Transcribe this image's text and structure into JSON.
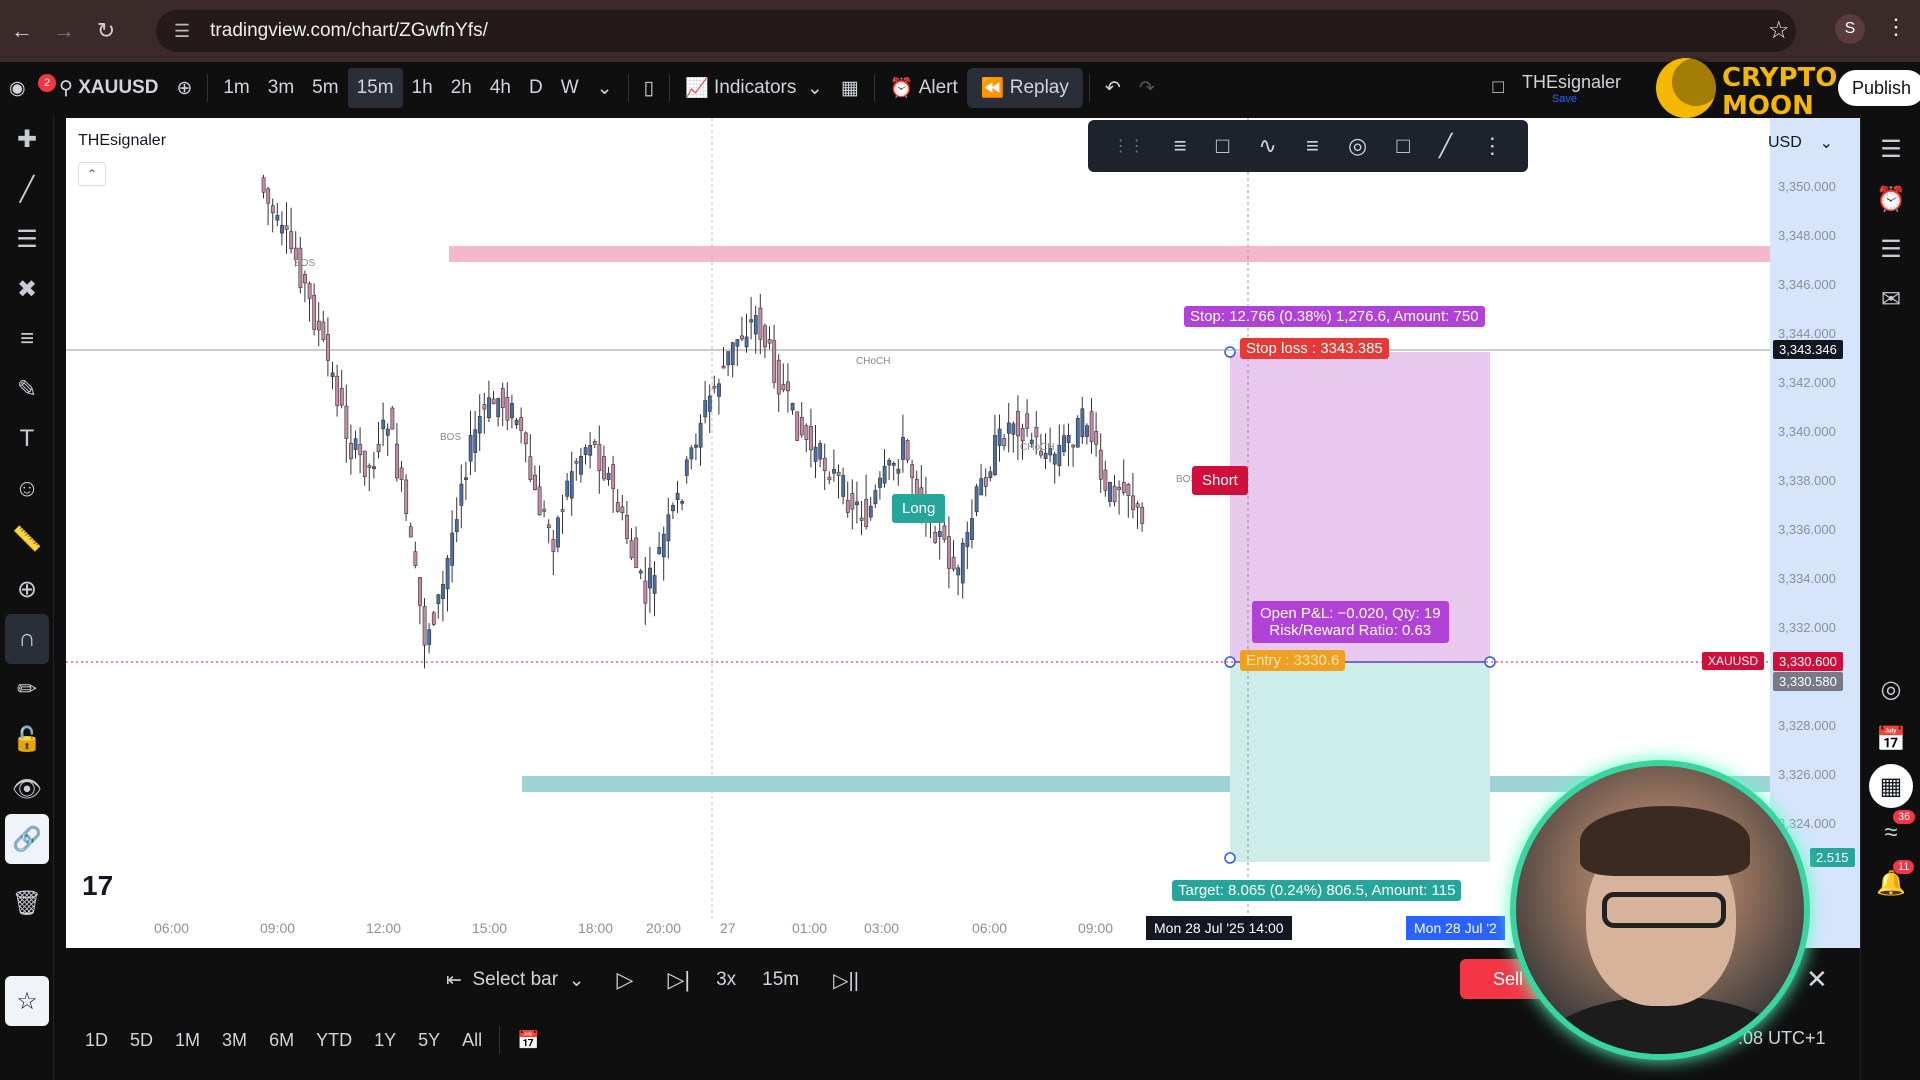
{
  "browser": {
    "url": "tradingview.com/chart/ZGwfnYfs/",
    "profile_initial": "S"
  },
  "toolbar": {
    "notification_count": "2",
    "symbol": "XAUUSD",
    "intervals": [
      "1m",
      "3m",
      "5m",
      "15m",
      "1h",
      "2h",
      "4h",
      "D",
      "W"
    ],
    "active_interval": "15m",
    "indicators_label": "Indicators",
    "alert_label": "Alert",
    "replay_label": "Replay",
    "account_name": "THEsignaler",
    "account_sub": "Save",
    "publish_label": "Publish",
    "logo_text": "CRYPTO MOON"
  },
  "chart": {
    "symbol_label": "THEsignaler",
    "currency": "USD",
    "price_ticks": [
      "3,350.000",
      "3,348.000",
      "3,346.000",
      "3,344.000",
      "3,342.000",
      "3,340.000",
      "3,338.000",
      "3,336.000",
      "3,334.000",
      "3,332.000",
      "3,330.000",
      "3,328.000",
      "3,326.000",
      "3,324.000"
    ],
    "time_ticks": [
      "06:00",
      "09:00",
      "12:00",
      "15:00",
      "18:00",
      "20:00",
      "27",
      "01:00",
      "03:00",
      "06:00",
      "09:00"
    ],
    "structure_labels": [
      "BOS",
      "BOS",
      "CHoCH",
      "CHoCH",
      "BOS"
    ],
    "stop_info": "Stop: 12.766 (0.38%) 1,276.6, Amount: 750",
    "stop_loss": "Stop loss : 3343.385",
    "short_label": "Short",
    "long_label": "Long",
    "pnl_line1": "Open P&L: −0.020, Qty: 19",
    "pnl_line2": "Risk/Reward Ratio: 0.63",
    "entry_label": "Entry : 3330.6",
    "target_info": "Target: 8.065 (0.24%) 806.5, Amount: 115",
    "crosshair_price": "3,343.346",
    "symbol_tag": "XAUUSD",
    "current_price": "3,330.600",
    "current_price2": "3,330.580",
    "target_price_tag": "2.515",
    "time_tag1": "Mon 28 Jul '25  14:00",
    "time_tag2": "Mon 28 Jul '2"
  },
  "replay_bar": {
    "select_bar": "Select bar",
    "speed": "3x",
    "interval": "15m",
    "sell_label": "Sell"
  },
  "range_bar": {
    "ranges": [
      "1D",
      "5D",
      "1M",
      "3M",
      "6M",
      "YTD",
      "1Y",
      "5Y",
      "All"
    ],
    "timezone": ":08 UTC+1"
  },
  "right_badges": {
    "b1": "36",
    "b2": "11"
  },
  "colors": {
    "bull": "#4a6fa5",
    "bear": "#c58aa8",
    "stop_zone": "#e8c8ee",
    "target_zone": "#cdeee8",
    "resistance": "#f4b8cc",
    "support": "#9ed3d6"
  }
}
